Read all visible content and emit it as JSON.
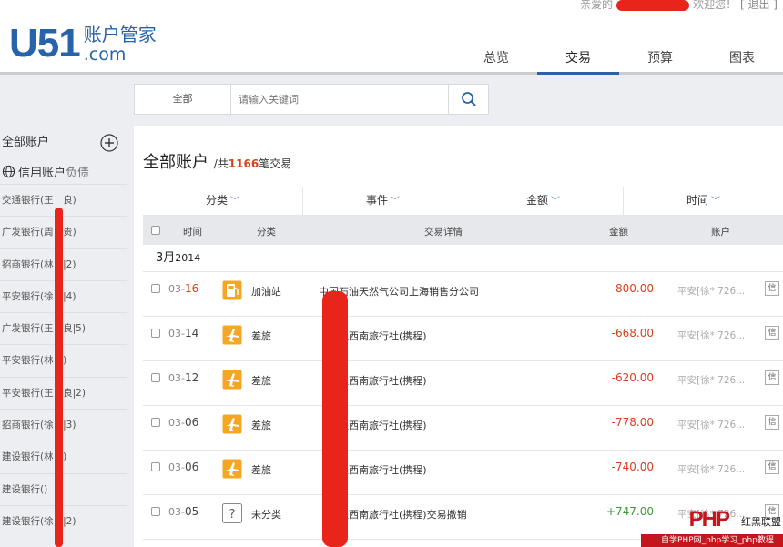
{
  "welcome": {
    "greeting": "亲爱的",
    "suffix": "欢迎您！",
    "logout": "[ 退出 ]"
  },
  "logo": {
    "brand": "U51",
    "cn": "账户管家",
    "domain": ".com"
  },
  "nav": {
    "tabs": [
      "总览",
      "交易",
      "预算",
      "图表"
    ],
    "active": "交易"
  },
  "search": {
    "scope": "全部",
    "placeholder": "请输入关键词"
  },
  "sidebar": {
    "all_accounts": "全部账户",
    "credit_label": "信用账户",
    "credit_sub": "负债",
    "items": [
      "交通银行(王　良)",
      "广发银行(周　贵)",
      "招商银行(林　|2)",
      "平安银行(徐　|4)",
      "广发银行(王　良|5)",
      "平安银行(林　)",
      "平安银行(王　良|2)",
      "招商银行(徐　|3)",
      "建设银行(林　)",
      "建设银行()",
      "建设银行(徐　|2)"
    ]
  },
  "main": {
    "title": "全部账户",
    "count_prefix": "/共",
    "count": "1166",
    "count_suffix": "笔交易",
    "filters": [
      "分类",
      "事件",
      "金额",
      "时间"
    ],
    "columns": {
      "time": "时间",
      "category": "分类",
      "detail": "交易详情",
      "amount": "金额",
      "account": "账户"
    },
    "month": "3月",
    "year": "2014",
    "rows": [
      {
        "month": "03-",
        "day": "16",
        "day_red": true,
        "icon": "gas-station-icon",
        "category": "加油站",
        "detail": "中国石油天然气公司上海销售分公司",
        "amount": "-800.00",
        "account": "平安[徐* 726...",
        "info": "信"
      },
      {
        "month": "03-",
        "day": "14",
        "icon": "airplane-icon",
        "category": "差旅",
        "detail": "　　程西南旅行社(携程)",
        "amount": "-668.00",
        "account": "平安[徐* 726...",
        "info": "信"
      },
      {
        "month": "03-",
        "day": "12",
        "icon": "airplane-icon",
        "category": "差旅",
        "detail": "　　程西南旅行社(携程)",
        "amount": "-620.00",
        "account": "平安[徐* 726...",
        "info": "信"
      },
      {
        "month": "03-",
        "day": "06",
        "icon": "airplane-icon",
        "category": "差旅",
        "detail": "　　程西南旅行社(携程)",
        "amount": "-778.00",
        "account": "平安[徐* 726...",
        "info": "信"
      },
      {
        "month": "03-",
        "day": "06",
        "icon": "airplane-icon",
        "category": "差旅",
        "detail": "　　程西南旅行社(携程)",
        "amount": "-740.00",
        "account": "平安[徐* 726...",
        "info": "信"
      },
      {
        "month": "03-",
        "day": "05",
        "icon": "question-icon",
        "category": "未分类",
        "detail": "　　程西南旅行社(携程)交易撤销",
        "amount": "+747.00",
        "account": "平安[徐* 726...",
        "info": "信"
      }
    ]
  },
  "watermark": {
    "mark": "PHP",
    "label": "红黑联盟",
    "strip": "自学PHP网_php学习_php教程"
  },
  "colors": {
    "brand": "#2763a8",
    "negative": "#d9401c",
    "positive": "#3a9a3a",
    "redaction": "#e8241b"
  }
}
